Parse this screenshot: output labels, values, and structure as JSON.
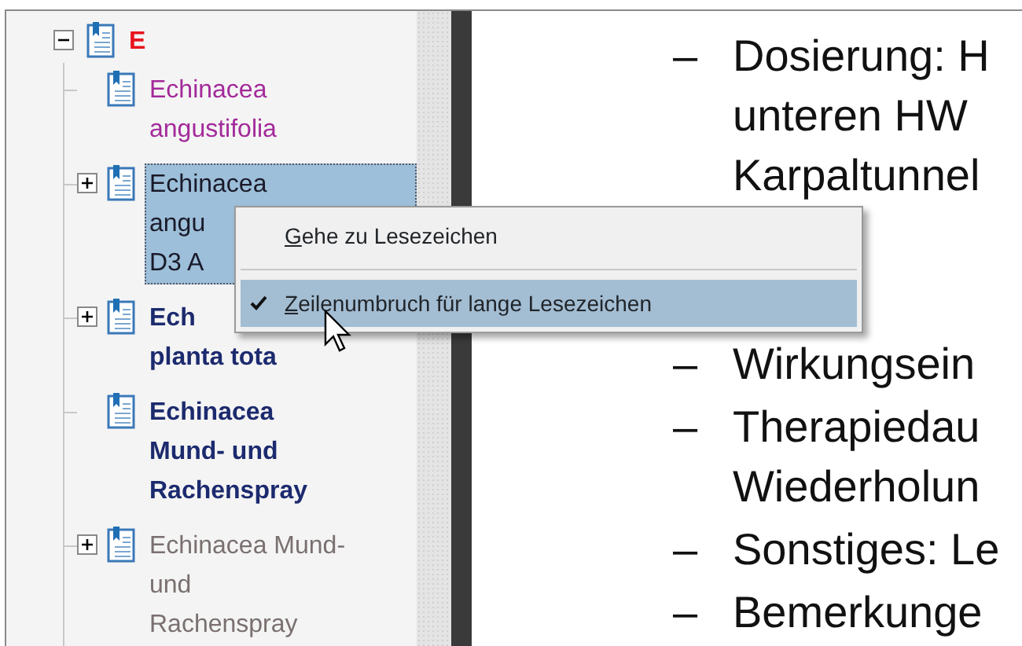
{
  "bookmarks": [
    {
      "lines": [
        "E"
      ],
      "kind": "red-bold",
      "expandable": true,
      "expanded": true,
      "selected": false,
      "children": [
        {
          "lines": [
            "Echinacea",
            "angustifolia"
          ],
          "kind": "purple",
          "expandable": false,
          "selected": false
        },
        {
          "lines": [
            "Echinacea",
            "angu",
            "D3 A"
          ],
          "kind": "plain",
          "expandable": true,
          "expanded": false,
          "selected": true
        },
        {
          "lines": [
            "Ech",
            "planta tota"
          ],
          "kind": "bold",
          "expandable": true,
          "expanded": false,
          "selected": false
        },
        {
          "lines": [
            "Echinacea",
            "Mund- und",
            "Rachenspray"
          ],
          "kind": "bold",
          "expandable": false,
          "selected": false
        },
        {
          "lines": [
            "Echinacea Mund-",
            "und",
            "Rachenspray"
          ],
          "kind": "grey",
          "expandable": true,
          "expanded": false,
          "selected": false
        }
      ]
    }
  ],
  "context_menu": [
    {
      "label": "Gehe zu Lesezeichen",
      "checked": false,
      "selected": false
    },
    {
      "label": "Zeilenumbruch für lange Lesezeichen",
      "checked": true,
      "selected": true
    }
  ],
  "document": [
    {
      "dash": "–",
      "lines": [
        "Dosierung: H",
        "unteren HW",
        "Karpaltunnel"
      ]
    },
    {
      "dash": "–",
      "lines": [
        "Wirkungsein"
      ]
    },
    {
      "dash": "–",
      "lines": [
        "Therapiedau",
        "Wiederholun"
      ]
    },
    {
      "dash": "–",
      "lines": [
        "Sonstiges: Le"
      ]
    },
    {
      "dash": "–",
      "lines": [
        "Bemerkunge"
      ]
    }
  ]
}
